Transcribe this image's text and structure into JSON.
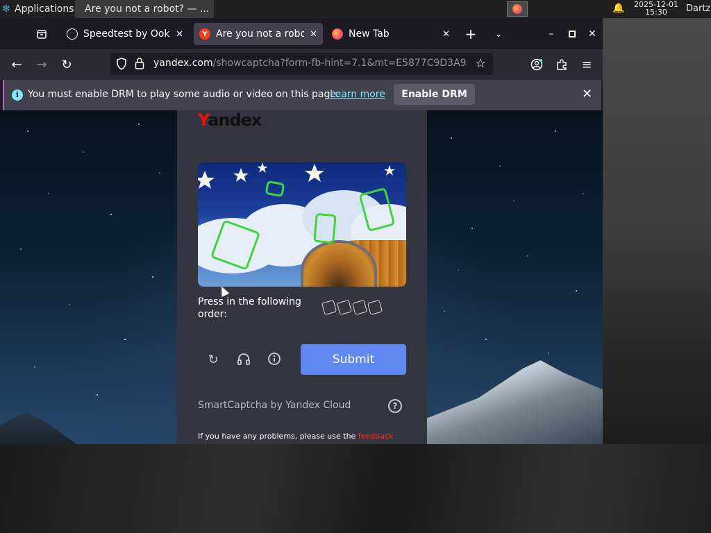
{
  "panel": {
    "apps_label": "Applications",
    "task_title": "Are you not a robot? — ...",
    "clock_date": "2025-12-01",
    "clock_time": "15:30",
    "user": "Dartz"
  },
  "tabs": [
    {
      "title": "Speedtest by Ookla",
      "favicon": "speedtest-icon",
      "active": false
    },
    {
      "title": "Are you not a robot?",
      "favicon": "yandex-icon",
      "active": true
    },
    {
      "title": "New Tab",
      "favicon": "firefox-icon",
      "active": false
    }
  ],
  "urlbar": {
    "domain": "yandex.com",
    "path": "/showcaptcha?form-fb-hint=7.1&mt=E5877C9D3A9"
  },
  "notice": {
    "message": "You must enable DRM to play some audio or video on this page.",
    "learn_more": "Learn more",
    "button": "Enable DRM"
  },
  "captcha": {
    "logo_first": "Y",
    "logo_rest": "andex",
    "instruction": "Press in the following order:",
    "submit": "Submit",
    "brand": "SmartCaptcha by Yandex Cloud",
    "problems_text": "If you have any problems, please use the",
    "problems_link": "feedback"
  },
  "colors": {
    "accent_button": "#5f89f1",
    "glyph_green": "#3dd63d",
    "link_red": "#ff2a2a"
  }
}
